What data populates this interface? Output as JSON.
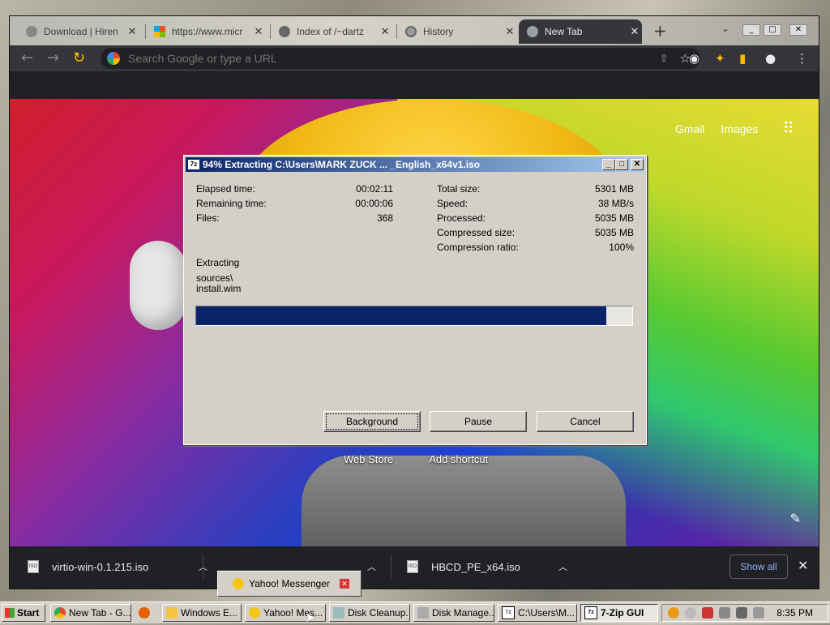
{
  "browser": {
    "tabs": [
      {
        "label": "Download | Hiren",
        "close": "✕"
      },
      {
        "label": "https://www.micr",
        "close": "✕"
      },
      {
        "label": "Index of /~dartz",
        "close": "✕"
      },
      {
        "label": "History",
        "close": "✕"
      },
      {
        "label": "New Tab",
        "close": "✕"
      }
    ],
    "new_tab_symbol": "+",
    "omnibox_placeholder": "Search Google or type a URL",
    "links": {
      "gmail": "Gmail",
      "images": "Images"
    },
    "shortcuts": [
      "Web Store",
      "Add shortcut"
    ],
    "downloads": [
      {
        "name": "virtio-win-0.1.215.iso"
      },
      {
        "name": "HBCD_PE_x64.iso"
      }
    ],
    "show_all": "Show all"
  },
  "dialog": {
    "title": "94% Extracting C:\\Users\\MARK ZUCK ... _English_x64v1.iso",
    "progress": 0.94,
    "left_stats": [
      {
        "label": "Elapsed time:",
        "value": "00:02:11"
      },
      {
        "label": "Remaining time:",
        "value": "00:00:06"
      },
      {
        "label": "Files:",
        "value": "368"
      }
    ],
    "right_stats": [
      {
        "label": "Total size:",
        "value": "5301 MB"
      },
      {
        "label": "Speed:",
        "value": "38 MB/s"
      },
      {
        "label": "Processed:",
        "value": "5035 MB"
      },
      {
        "label": "Compressed size:",
        "value": "5035 MB"
      },
      {
        "label": "Compression ratio:",
        "value": "100%"
      }
    ],
    "status_label": "Extracting",
    "current_path": "sources\\",
    "current_file": "install.wim",
    "buttons": {
      "background": "Background",
      "pause": "Pause",
      "cancel": "Cancel"
    }
  },
  "yahoo_popup": {
    "label": "Yahoo! Messenger"
  },
  "taskbar": {
    "start": "Start",
    "items": [
      {
        "label": "New Tab - G..."
      },
      {
        "label": "Windows E..."
      },
      {
        "label": "Yahoo! Mes..."
      },
      {
        "label": "Disk Cleanup..."
      },
      {
        "label": "Disk Manage..."
      },
      {
        "label": "C:\\Users\\M..."
      },
      {
        "label": "7-Zip GUI"
      }
    ],
    "clock": "8:35 PM"
  },
  "colors": {
    "title_bar": "#0a246a",
    "progress_fill": "#0a246a",
    "chrome_dark": "#202124",
    "link_blue": "#8ab4f8"
  },
  "icons": [
    "back-arrow-icon",
    "forward-arrow-icon",
    "reload-icon",
    "google-icon",
    "share-icon",
    "star-icon",
    "extension-icon",
    "sidepanel-icon",
    "profile-icon",
    "menu-icon",
    "apps-grid-icon",
    "pencil-icon",
    "iso-file-icon",
    "chevron-up-icon",
    "close-icon",
    "windows-flag-icon",
    "7zip-icon",
    "yahoo-smiley-icon"
  ]
}
